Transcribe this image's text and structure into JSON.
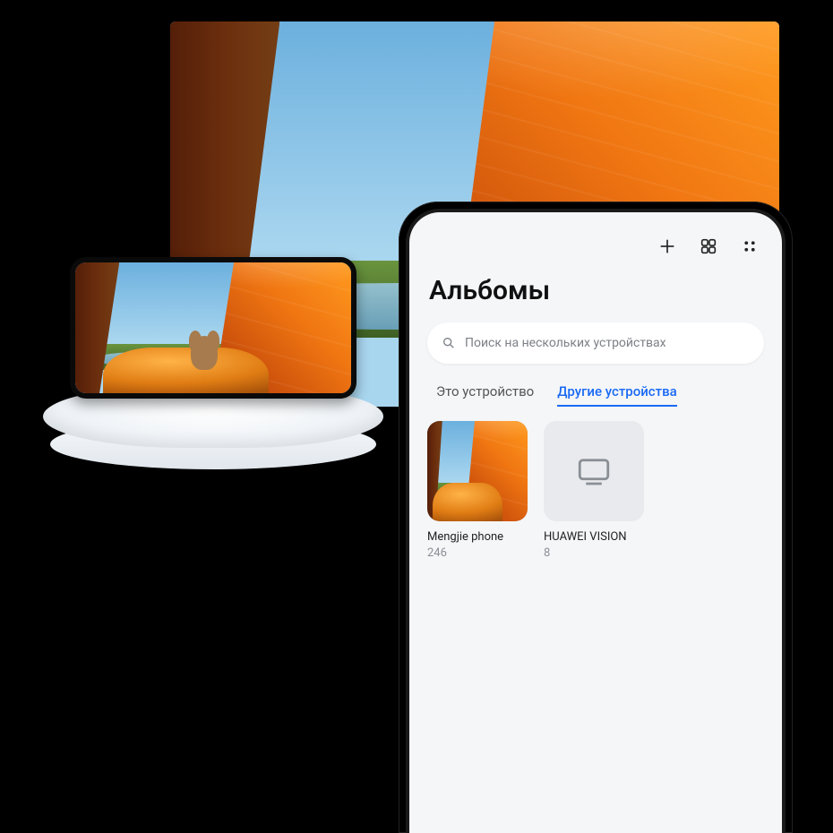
{
  "gallery": {
    "title": "Альбомы",
    "search_placeholder": "Поиск на нескольких устройствах",
    "tabs": {
      "this_device": "Это устройство",
      "other_devices": "Другие устройства"
    },
    "devices": [
      {
        "name": "Mengjie phone",
        "count": "246",
        "icon": "photo-scene"
      },
      {
        "name": "HUAWEI VISION",
        "count": "8",
        "icon": "tv"
      }
    ]
  },
  "icons": {
    "add": "plus-icon",
    "grid": "grid-icon",
    "more": "more-icon",
    "search": "search-icon",
    "tv": "tv-icon"
  }
}
